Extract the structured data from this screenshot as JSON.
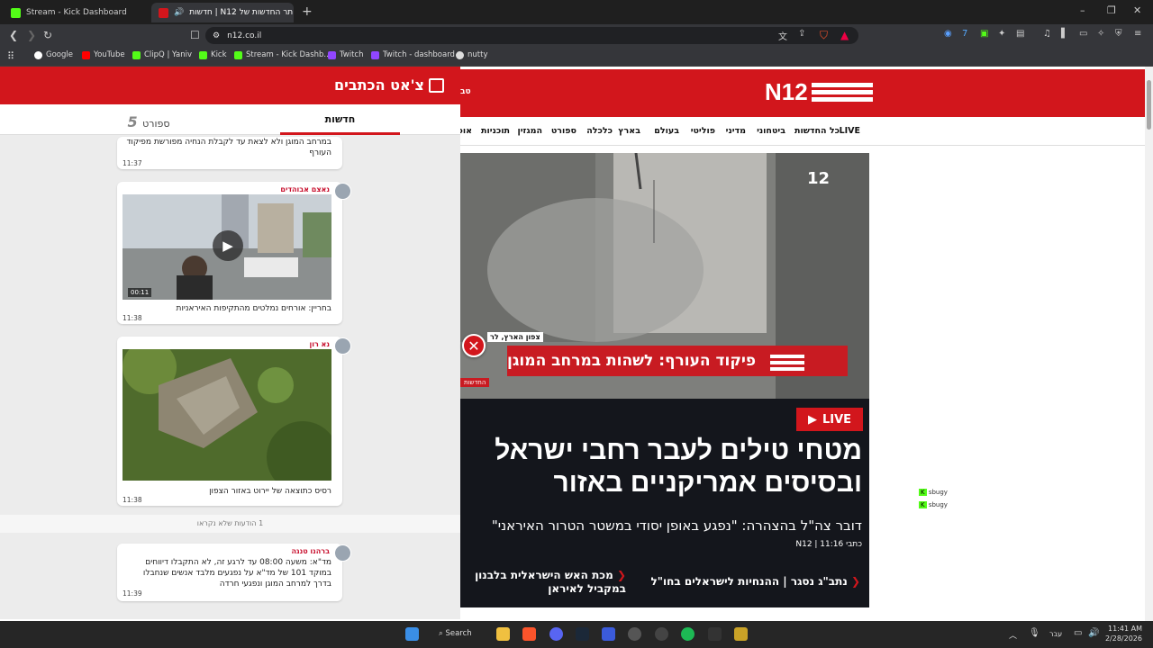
{
  "browser": {
    "tabs": [
      {
        "title": "Stream - Kick Dashboard",
        "active": false
      },
      {
        "title": "חדשות | N12 אתר החדשות של",
        "active": true
      }
    ],
    "new_tab": "+",
    "window_controls": [
      "–",
      "❐",
      "✕"
    ],
    "url": "n12.co.il",
    "bookmarks": [
      "Google",
      "YouTube",
      "ClipQ | Yaniv",
      "Kick",
      "Stream - Kick Dashb...",
      "Twitch",
      "Twitch - dashboard",
      "nutty"
    ]
  },
  "site": {
    "logo_text": "N12",
    "nav": [
      "LIVE",
      "כל החדשות",
      "ביטחוני",
      "מדיני",
      "פוליטי",
      "בעולם",
      "בארץ",
      "כלכלה",
      "ספורט",
      "המגזין",
      "תוכניות",
      "אוכ"
    ],
    "nav_cut": "טב",
    "video": {
      "banner": "פיקוד העורף: לשהות במרחב המוגן",
      "location": "צפון הארץ, לר",
      "channel_tag": "החדשות",
      "channel_number": "12"
    },
    "live_label": "LIVE",
    "headline": "מטחי טילים לעבר רחבי ישראל ובסיסים אמריקניים באזור",
    "subheadline": "דובר צה\"ל בהצהרה: \"נפגע באופן יסודי במשטר הטרור האיראני\"",
    "byline": "כתבי N12 | 11:16",
    "related": [
      "נתב\"ג נסגר | ההנחיות לישראלים בחו\"ל",
      "מכת האש הישראלית בלבנון במקביל לאיראן"
    ]
  },
  "chat_panel": {
    "title": "צ'אט הכתבים",
    "tabs": [
      "חדשות",
      "ספורט"
    ],
    "cards": [
      {
        "author": "",
        "text": "במרחב המוגן ולא לצאת עד לקבלת הנחיה מפורשת מפיקוד העורף",
        "time": "11:37"
      },
      {
        "author": "נאצם אבוהדים",
        "text": "בחריין: אורחים נמלטים מהתקיפות האיראניות",
        "time": "11:38",
        "video_duration": "00:11"
      },
      {
        "author": "נא רון",
        "text": "רסיס כתוצאה של יירוט באזור הצפון",
        "time": "11:38"
      },
      {
        "author": "ברהנו טנגה",
        "text": "מד\"א: משעה 08:00 עד לרגע זה, לא התקבלו דיווחים במוקד 101 של מד\"א על נפגעים מלבד אנשים שנחבלו בדרך למרחב המוגן ונפגעי חרדה",
        "time": "11:39"
      }
    ],
    "unread": "1 הודעות שלא נקראו"
  },
  "overlay_tags": [
    "sbugy",
    "sbugy"
  ],
  "taskbar": {
    "search": "Search",
    "lang": "עבר",
    "time": "11:41 AM",
    "date": "2/28/2026"
  },
  "colors": {
    "brand_red": "#d2161c",
    "kick_green": "#53fc18",
    "twitch_purple": "#9146ff"
  }
}
